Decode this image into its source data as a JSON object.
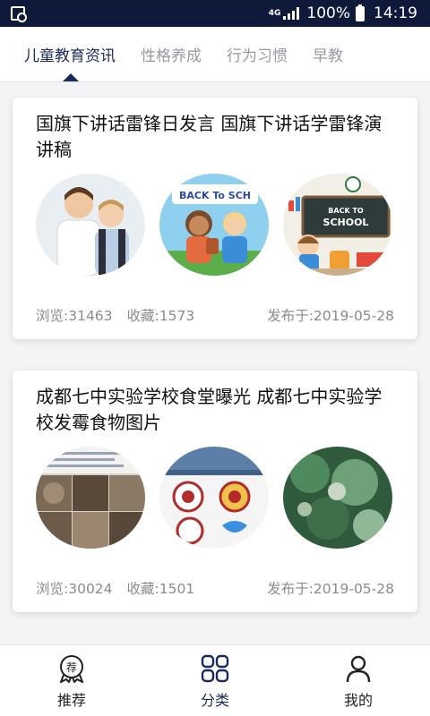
{
  "status_bar": {
    "network": "4G",
    "battery": "100%",
    "time": "14:19"
  },
  "tabs": [
    {
      "label": "儿童教育资讯",
      "active": true
    },
    {
      "label": "性格养成",
      "active": false
    },
    {
      "label": "行为习惯",
      "active": false
    },
    {
      "label": "早教",
      "active": false
    }
  ],
  "articles": [
    {
      "title": "国旗下讲话雷锋日发言 国旗下讲话学雷锋演讲稿",
      "views": "浏览:31463",
      "favorites": "收藏:1573",
      "date": "发布于:2019-05-28",
      "thumb_text": [
        "",
        "BACK To SCH",
        "BACK TO SCHOOL"
      ]
    },
    {
      "title": "成都七中实验学校食堂曝光 成都七中实验学校发霉食物图片",
      "views": "浏览:30024",
      "favorites": "收藏:1501",
      "date": "发布于:2019-05-28",
      "thumb_text": [
        "",
        "",
        ""
      ]
    }
  ],
  "bottom_nav": [
    {
      "label": "推荐",
      "icon": "recommend-badge-icon",
      "badge_char": "荐"
    },
    {
      "label": "分类",
      "icon": "grid-category-icon",
      "active": true
    },
    {
      "label": "我的",
      "icon": "user-profile-icon"
    }
  ],
  "colors": {
    "status_bar": "#0f1a3a",
    "accent": "#1a2a5e",
    "inactive_tab": "#9a9aa2",
    "meta_text": "#8a8a90"
  }
}
